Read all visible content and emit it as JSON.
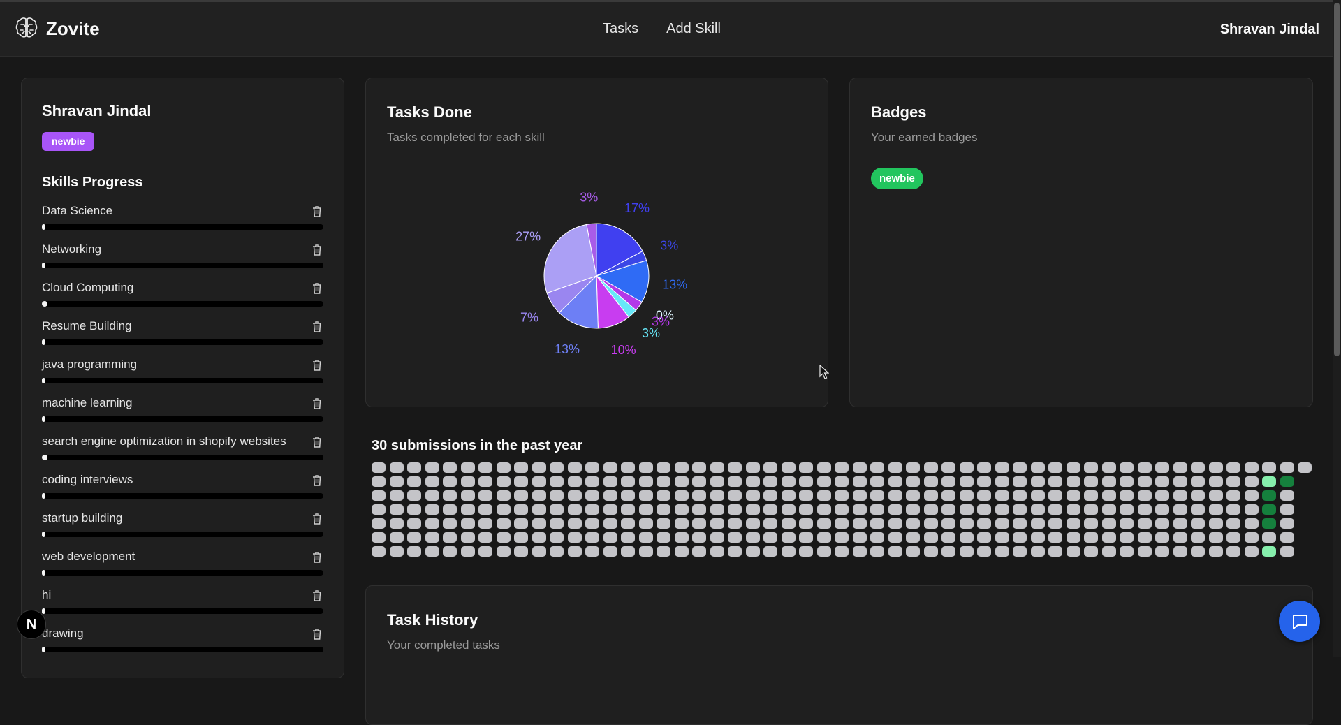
{
  "navbar": {
    "brand": "Zovite",
    "links": [
      "Tasks",
      "Add Skill"
    ],
    "user": "Shravan Jindal"
  },
  "profile": {
    "name": "Shravan Jindal",
    "badge": "newbie",
    "skills_title": "Skills Progress",
    "skills": [
      {
        "name": "Data Science",
        "progress": 0.01
      },
      {
        "name": "Networking",
        "progress": 0.01
      },
      {
        "name": "Cloud Computing",
        "progress": 0.02
      },
      {
        "name": "Resume Building",
        "progress": 0.0
      },
      {
        "name": "java programming",
        "progress": 0.01
      },
      {
        "name": "machine learning",
        "progress": 0.01
      },
      {
        "name": "search engine optimization in shopify websites",
        "progress": 0.02
      },
      {
        "name": "coding interviews",
        "progress": 0.0
      },
      {
        "name": "startup building",
        "progress": 0.01
      },
      {
        "name": "web development",
        "progress": 0.0
      },
      {
        "name": "hi",
        "progress": 0.0
      },
      {
        "name": "drawing",
        "progress": 0.0
      }
    ]
  },
  "tasks_done": {
    "title": "Tasks Done",
    "subtitle": "Tasks completed for each skill"
  },
  "chart_data": {
    "type": "pie",
    "slices": [
      {
        "value": 17,
        "label": "17%",
        "color": "#4040f0"
      },
      {
        "value": 3,
        "label": "3%",
        "color": "#3b46e6"
      },
      {
        "value": 13,
        "label": "13%",
        "color": "#2f6bf5"
      },
      {
        "value": 0,
        "label": "0%",
        "color": "#ffffff"
      },
      {
        "value": 3,
        "label": "3%",
        "color": "#b338e8"
      },
      {
        "value": 3,
        "label": "3%",
        "color": "#67e8f9"
      },
      {
        "value": 10,
        "label": "10%",
        "color": "#c83df0"
      },
      {
        "value": 13,
        "label": "13%",
        "color": "#6d7ff5"
      },
      {
        "value": 7,
        "label": "7%",
        "color": "#9a86f0"
      },
      {
        "value": 27,
        "label": "27%",
        "color": "#ab9ff5"
      },
      {
        "value": 3,
        "label": "3%",
        "color": "#a85ce8"
      }
    ]
  },
  "badges": {
    "title": "Badges",
    "subtitle": "Your earned badges",
    "items": [
      "newbie"
    ]
  },
  "submissions": {
    "title": "30 submissions in the past year",
    "weeks": 53,
    "days": 7,
    "colors": {
      "empty": "#c4c4c8",
      "light": "#86efac",
      "dark": "#15803d"
    },
    "active": [
      {
        "week": 50,
        "day": 1,
        "level": "light"
      },
      {
        "week": 51,
        "day": 1,
        "level": "dark"
      },
      {
        "week": 50,
        "day": 2,
        "level": "dark"
      },
      {
        "week": 50,
        "day": 3,
        "level": "dark"
      },
      {
        "week": 50,
        "day": 4,
        "level": "dark"
      },
      {
        "week": 50,
        "day": 6,
        "level": "light"
      }
    ]
  },
  "task_history": {
    "title": "Task History",
    "subtitle": "Your completed tasks"
  },
  "overlay": {
    "next_glyph": "N"
  }
}
